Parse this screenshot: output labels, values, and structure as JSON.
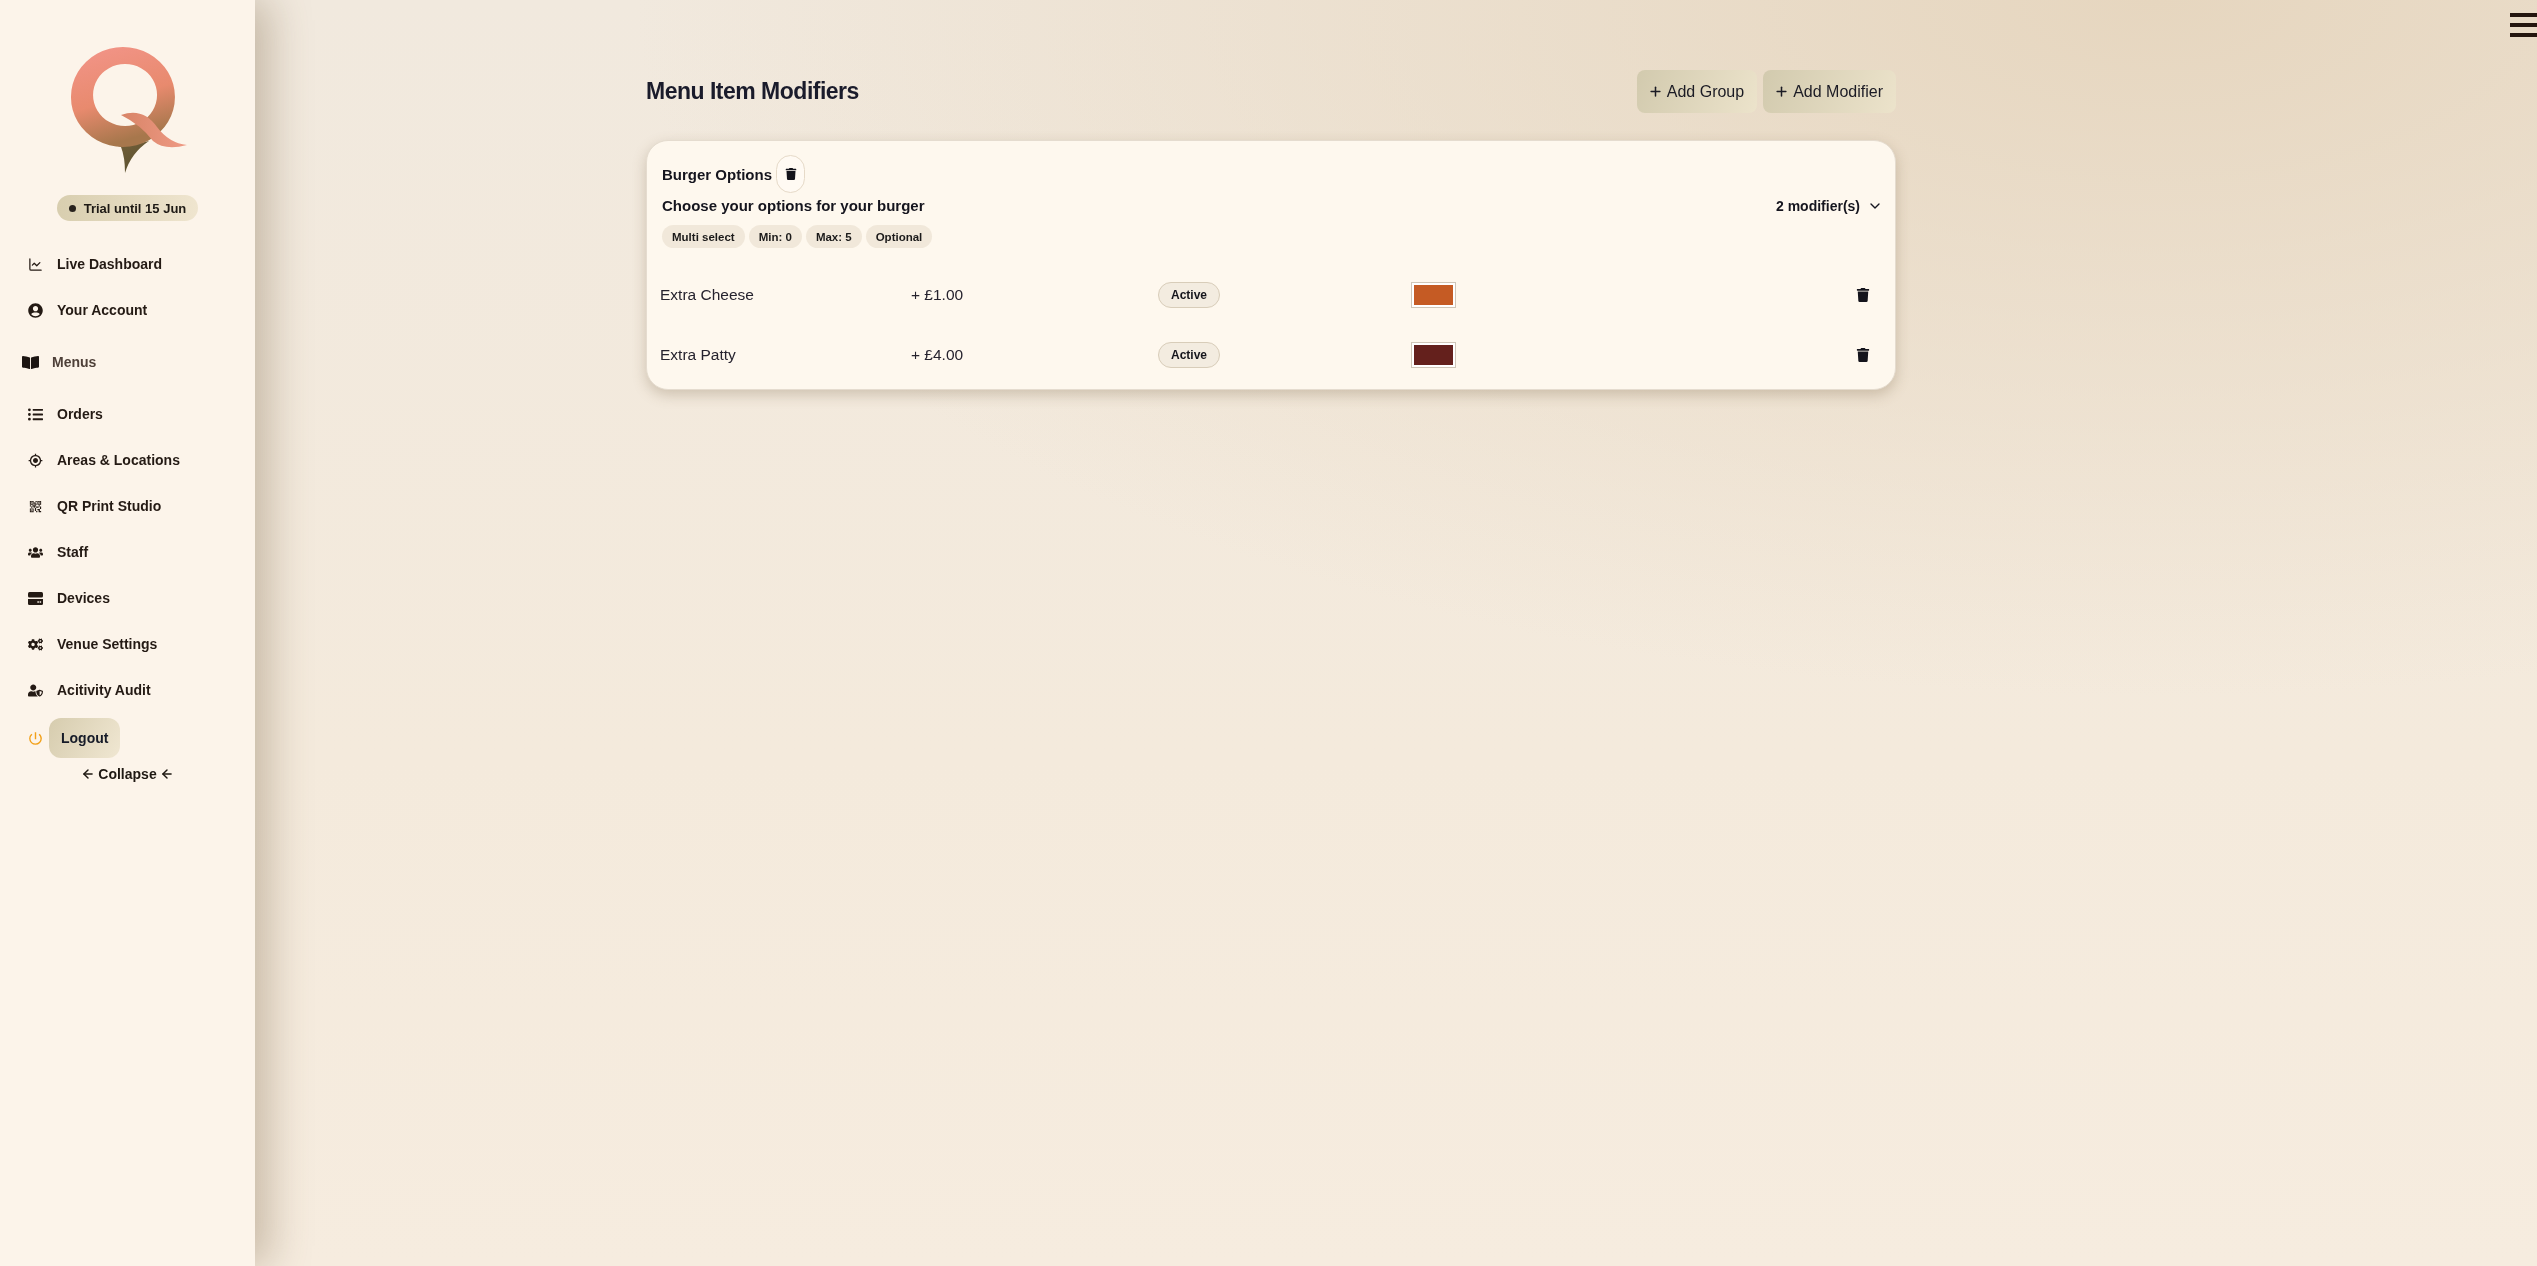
{
  "sidebar": {
    "trial_badge": "Trial until 15 Jun",
    "items": [
      {
        "label": "Live Dashboard",
        "selected": false
      },
      {
        "label": "Your Account",
        "selected": false
      },
      {
        "label": "Menus",
        "selected": true
      },
      {
        "label": "Orders",
        "selected": false
      },
      {
        "label": "Areas & Locations",
        "selected": false
      },
      {
        "label": "QR Print Studio",
        "selected": false
      },
      {
        "label": "Staff",
        "selected": false
      },
      {
        "label": "Devices",
        "selected": false
      },
      {
        "label": "Venue Settings",
        "selected": false
      },
      {
        "label": "Acitivity Audit",
        "selected": false
      }
    ],
    "logout": "Logout",
    "collapse": "Collapse"
  },
  "header": {
    "title": "Menu Item Modifiers",
    "actions": [
      "Add Group",
      "Add Modifier"
    ]
  },
  "groups": [
    {
      "name": "Burger Options",
      "description": "Choose your options for your burger",
      "count": "2 modifier(s)",
      "expanded": true,
      "settings": [
        "Multi select",
        "Min: 0",
        "Max: 5",
        "Optional"
      ],
      "modifiers": [
        {
          "name": "Extra Cheese",
          "price": "+ £1.00",
          "status": "Active",
          "color": "#c55b24"
        },
        {
          "name": "Extra Patty",
          "price": "+ £4.00",
          "status": "Active",
          "color": "#64201c"
        }
      ]
    }
  ]
}
